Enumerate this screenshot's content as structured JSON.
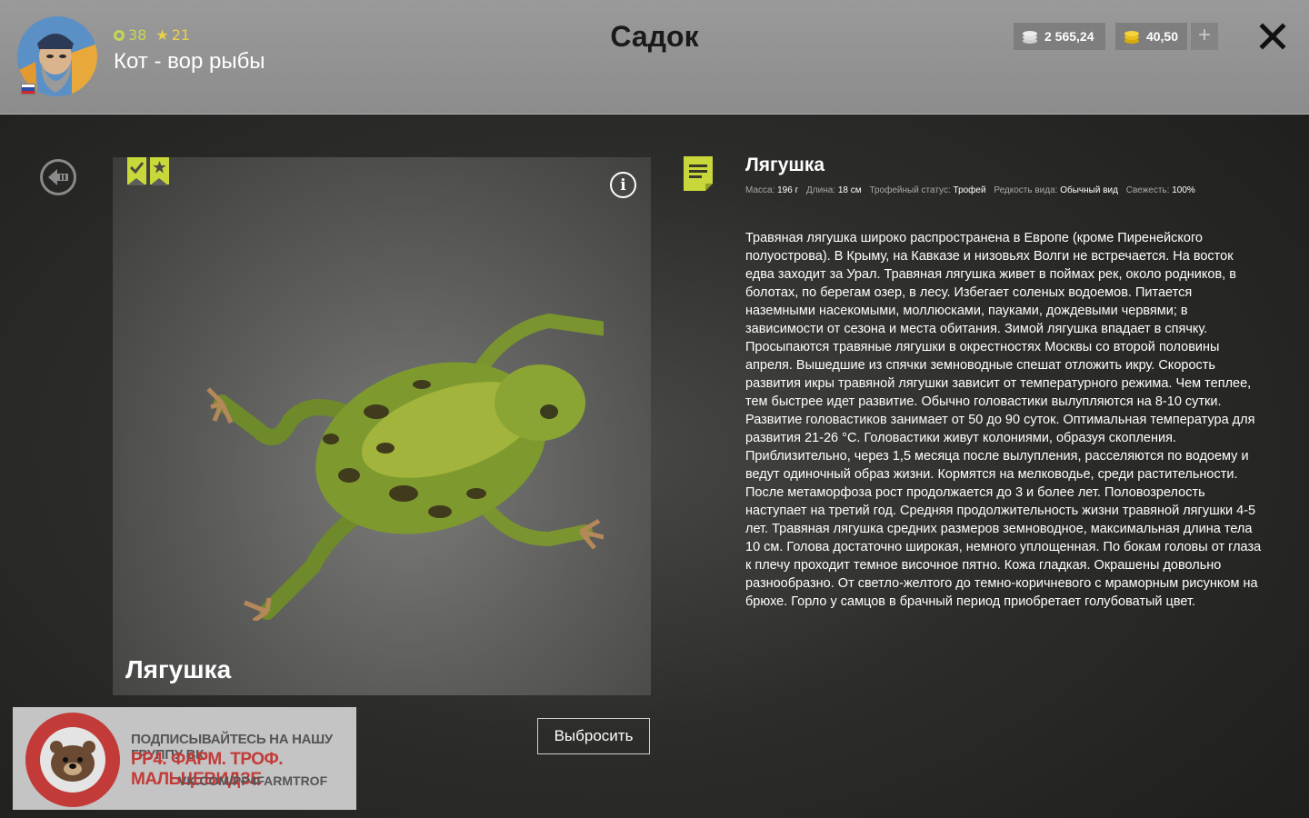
{
  "header": {
    "title": "Садок",
    "player": {
      "name": "Кот - вор рыбы",
      "level": "38",
      "rating": "21"
    },
    "currencies": {
      "silver": "2 565,24",
      "gold": "40,50"
    },
    "add_label": "+",
    "icons": {
      "avatar": "fisherman-avatar",
      "flag": "russia-flag-icon",
      "silver": "silver-coins-icon",
      "gold": "gold-coins-icon",
      "close": "close-icon"
    }
  },
  "nav": {
    "back_icon": "back-arrow-icon"
  },
  "card": {
    "name": "Лягушка",
    "badges": [
      "check-bookmark-icon",
      "star-bookmark-icon"
    ],
    "info_label": "i"
  },
  "actions": {
    "release_label": "Выбросить"
  },
  "detail": {
    "title": "Лягушка",
    "props": {
      "mass_label": "Масса:",
      "mass_value": "196 г",
      "length_label": "Длина:",
      "length_value": "18 см",
      "trophy_label": "Трофейный статус:",
      "trophy_value": "Трофей",
      "rarity_label": "Редкость вида:",
      "rarity_value": "Обычный вид",
      "freshness_label": "Свежесть:",
      "freshness_value": "100%"
    },
    "description": "Травяная лягушка широко распространена в Европе (кроме Пиренейского полуострова). В Крыму, на Кавказе и низовьях Волги не встречается. На восток едва заходит за Урал. Травяная лягушка живет в поймах рек, около родников, в болотах, по берегам озер, в лесу. Избегает соленых водоемов. Питается наземными насекомыми, моллюсками, пауками, дождевыми червями; в зависимости от сезона и места обитания. Зимой лягушка впадает в спячку. Просыпаются травяные лягушки в окрестностях Москвы со второй половины апреля. Вышедшие из спячки земноводные спешат отложить икру. Скорость развития икры травяной лягушки зависит от температурного режима. Чем теплее, тем быстрее идет развитие. Обычно головастики вылупляются на 8-10 сутки. Развитие головастиков занимает от 50 до 90 суток. Оптимальная температура для развития 21-26 °С. Головастики живут колониями, образуя скопления. Приблизительно, через 1,5 месяца после вылупления, расселяются по водоему и ведут одиночный образ жизни. Кормятся на мелководье, среди растительности. После метаморфоза рост продолжается до 3 и более лет. Половозрелость наступает на третий год. Средняя продолжительность жизни травяной лягушки 4-5 лет. Травяная лягушка средних размеров земноводное, максимальная длина тела 10 см. Голова достаточно широкая, немного уплощенная. По бокам головы от глаза к плечу проходит темное височное пятно. Кожа гладкая. Окрашены довольно разнообразно. От светло-желтого до темно-коричневого с мраморным рисунком на брюхе. Горло у самцов в брачный период приобретает голубоватый цвет.",
    "icon": "notes-icon"
  },
  "promo": {
    "line1": "ПОДПИСЫВАЙТЕСЬ НА НАШУ ГРУППУ ВК:",
    "line2": "РР4. ФАРМ. ТРОФ. МАЛЬЦЕВИДЗЕ",
    "line3": "VK.COM/PP4FARMTROF"
  },
  "colors": {
    "accent_green": "#c8d83a",
    "level_green": "#c7d655",
    "rating_yellow": "#e8d24a",
    "promo_red": "#c23b38"
  }
}
